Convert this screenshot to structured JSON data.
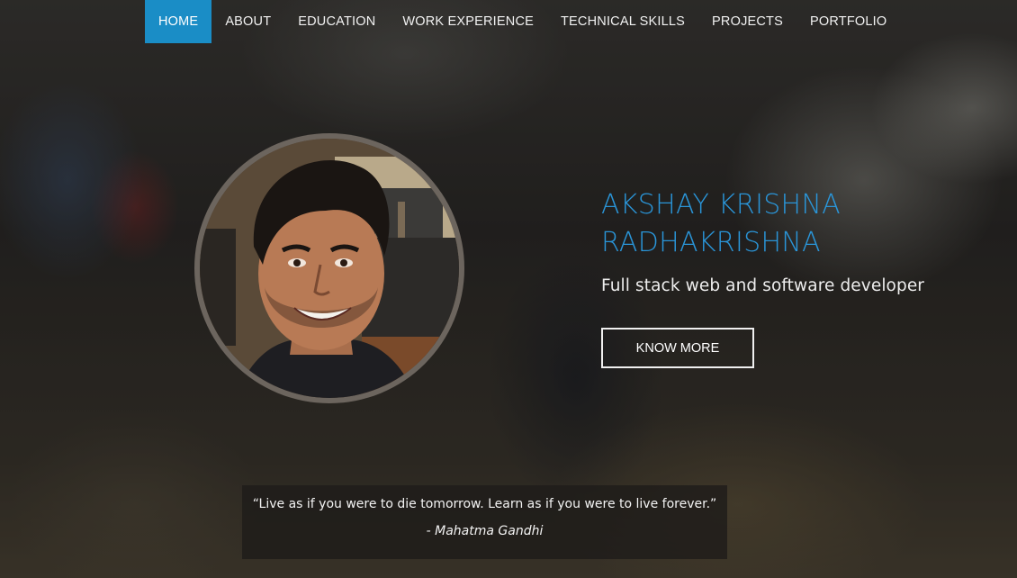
{
  "nav": {
    "items": [
      {
        "label": "HOME",
        "active": true
      },
      {
        "label": "ABOUT"
      },
      {
        "label": "EDUCATION"
      },
      {
        "label": "WORK EXPERIENCE"
      },
      {
        "label": "TECHNICAL SKILLS"
      },
      {
        "label": "PROJECTS"
      },
      {
        "label": "PORTFOLIO"
      }
    ]
  },
  "hero": {
    "name_line1": "AKSHAY KRISHNA",
    "name_line2": "RADHAKRISHNA",
    "subtitle": "Full stack web and software developer",
    "cta_label": "KNOW MORE"
  },
  "quote": {
    "text": "“Live as if you were to die tomorrow. Learn as if you were to live forever.”",
    "author": "- Mahatma Gandhi"
  },
  "colors": {
    "accent": "#1a8dc6",
    "name": "#2a95d8"
  }
}
